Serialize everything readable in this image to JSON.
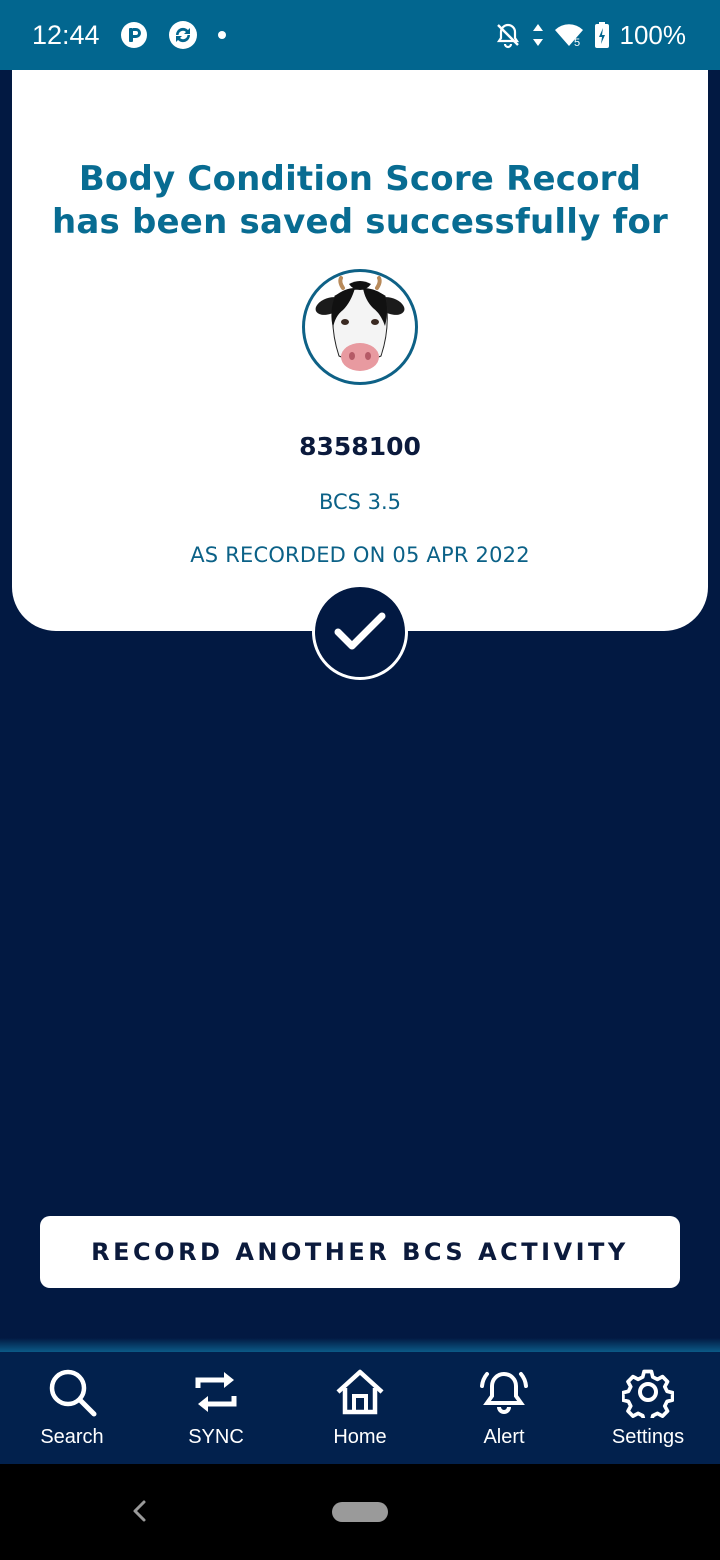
{
  "status_bar": {
    "time": "12:44",
    "battery": "100%"
  },
  "card": {
    "title_line1": "Body Condition Score Record",
    "title_line2": "has been saved successfully for",
    "animal_id": "8358100",
    "bcs": "BCS 3.5",
    "recorded_on": "AS RECORDED ON 05 APR 2022"
  },
  "actions": {
    "record_another": "RECORD ANOTHER BCS ACTIVITY"
  },
  "nav": {
    "items": [
      {
        "label": "Search",
        "icon": "search-icon"
      },
      {
        "label": "SYNC",
        "icon": "sync-icon"
      },
      {
        "label": "Home",
        "icon": "home-icon"
      },
      {
        "label": "Alert",
        "icon": "alert-bell-icon"
      },
      {
        "label": "Settings",
        "icon": "gear-icon"
      }
    ]
  },
  "colors": {
    "background": "#021942",
    "status_bar": "#02668f",
    "title": "#086c92",
    "nav_bar": "#02214d"
  }
}
